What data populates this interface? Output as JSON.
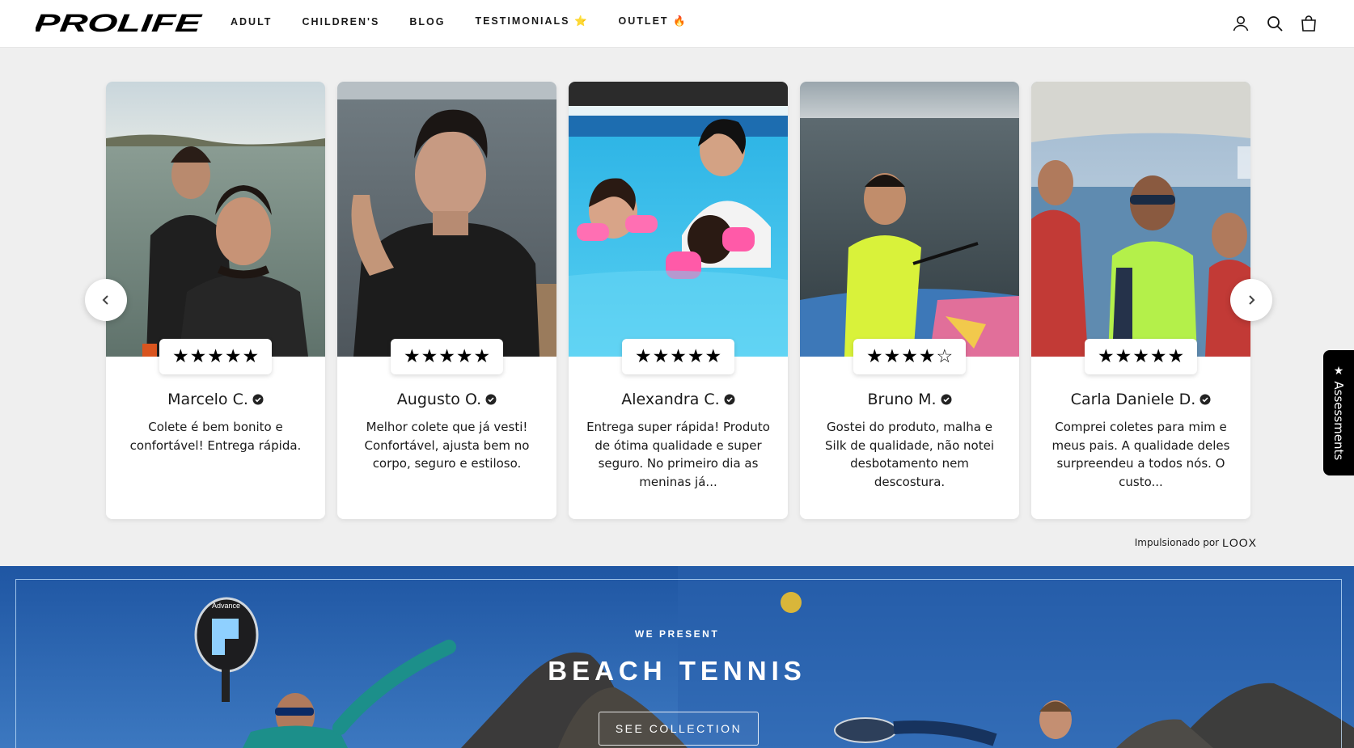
{
  "brand": {
    "logo_text": "PROLIFE"
  },
  "nav": {
    "items": [
      {
        "label": "ADULT"
      },
      {
        "label": "CHILDREN'S"
      },
      {
        "label": "BLOG"
      },
      {
        "label": "TESTIMONIALS ⭐"
      },
      {
        "label": "OUTLET 🔥"
      }
    ]
  },
  "header_icons": [
    "account-icon",
    "search-icon",
    "cart-icon"
  ],
  "reviews": [
    {
      "name": "Marcelo C.",
      "rating": 5,
      "text": "Colete é bem bonito e confortável! Entrega rápida."
    },
    {
      "name": "Augusto O.",
      "rating": 5,
      "text": "Melhor colete que já vesti! Confortável, ajusta bem no corpo, seguro e estiloso."
    },
    {
      "name": "Alexandra C.",
      "rating": 5,
      "text": "Entrega super rápida! Produto de ótima qualidade e super seguro. No primeiro dia as meninas já..."
    },
    {
      "name": "Bruno M.",
      "rating": 4,
      "text": "Gostei do produto, malha e Silk de qualidade, não notei desbotamento nem descostura."
    },
    {
      "name": "Carla Daniele D.",
      "rating": 5,
      "text": "Comprei coletes para mim e meus pais. A qualidade deles surpreendeu a todos nós. O custo..."
    }
  ],
  "powered_by": {
    "prefix": "Impulsionado por",
    "brand": "LOOX"
  },
  "side_tab": {
    "label": "Assessments"
  },
  "hero": {
    "eyebrow": "WE PRESENT",
    "title": "BEACH TENNIS",
    "button_label": "SEE COLLECTION",
    "paddle_brand": "Advance"
  },
  "colors": {
    "header_bg": "#ffffff",
    "page_bg": "#efefef",
    "hero_sky": "#2a5fa8",
    "tab_bg": "#000000"
  }
}
